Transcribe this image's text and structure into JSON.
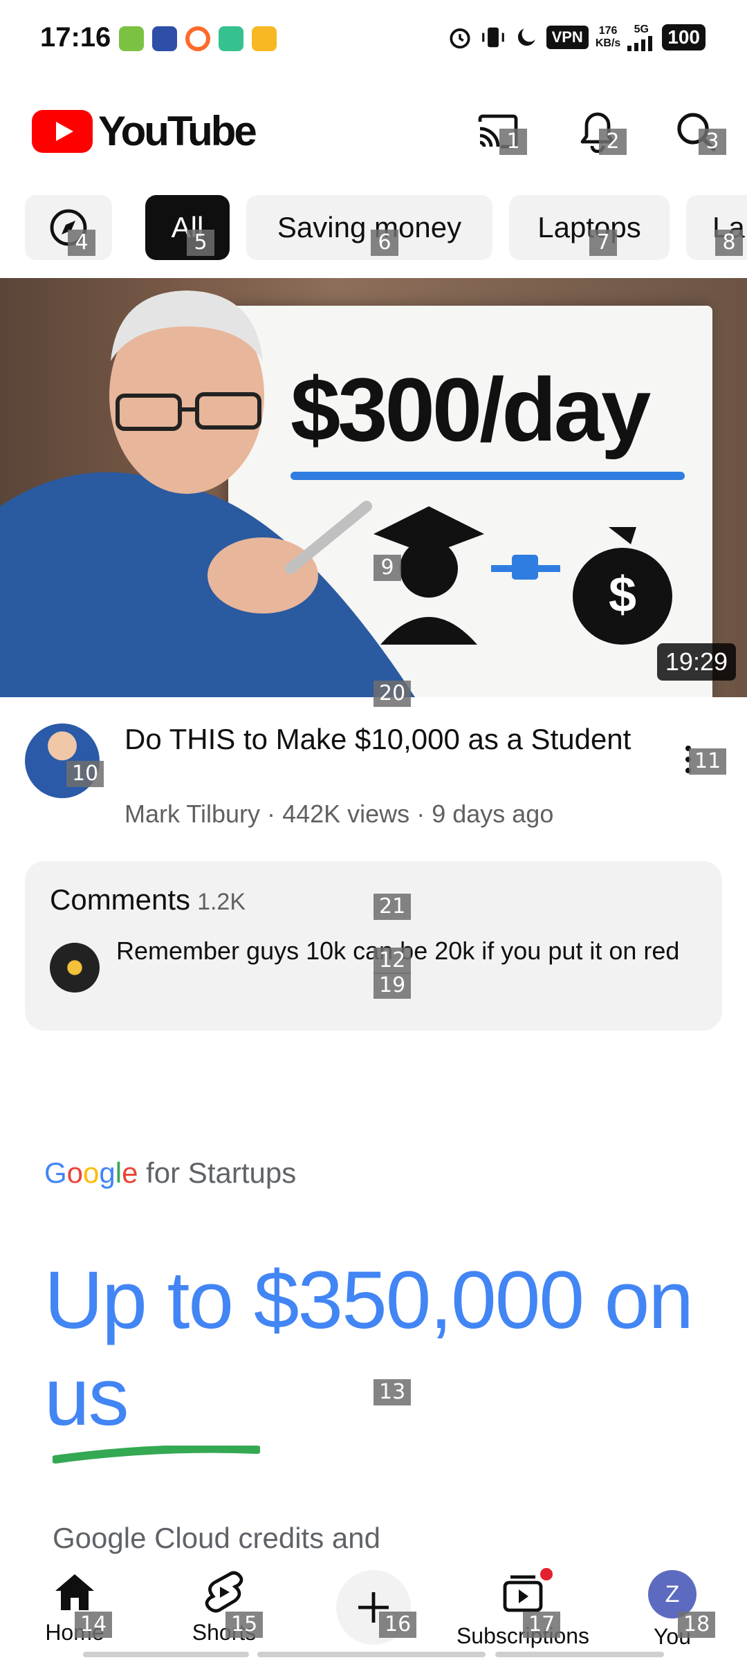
{
  "status_bar": {
    "time": "17:16",
    "vpn": "VPN",
    "speed_value": "176",
    "speed_unit": "KB/s",
    "network": "5G",
    "battery": "100"
  },
  "header": {
    "app_name": "YouTube",
    "brand_color": "#ff0000",
    "icons": [
      "cast-icon",
      "bell-icon",
      "search-icon"
    ]
  },
  "chips": {
    "items": [
      "All",
      "Saving money",
      "Laptops",
      "La"
    ],
    "active": "All"
  },
  "video": {
    "thumbnail_text": "$300/day",
    "duration": "19:29",
    "title": "Do THIS to Make $10,000 as a Student",
    "channel": "Mark Tilbury",
    "views": "442K views",
    "age": "9 days ago",
    "separator": "·"
  },
  "comments": {
    "label": "Comments",
    "count": "1.2K",
    "top_comment": "Remember guys 10k can be 20k if you put it on red"
  },
  "ad": {
    "brand_letters": [
      "G",
      "o",
      "o",
      "g",
      "l",
      "e"
    ],
    "brand_rest": "for Startups",
    "headline": "Up to $350,000 on us",
    "copy": "Google Cloud credits and"
  },
  "bottom_nav": {
    "home": "Home",
    "shorts": "Shorts",
    "subscriptions": "Subscriptions",
    "you": "You",
    "you_initial": "Z"
  },
  "marks": [
    "1",
    "2",
    "3",
    "4",
    "5",
    "6",
    "7",
    "8",
    "9",
    "10",
    "11",
    "12",
    "13",
    "14",
    "15",
    "16",
    "17",
    "18",
    "19",
    "20",
    "21"
  ]
}
